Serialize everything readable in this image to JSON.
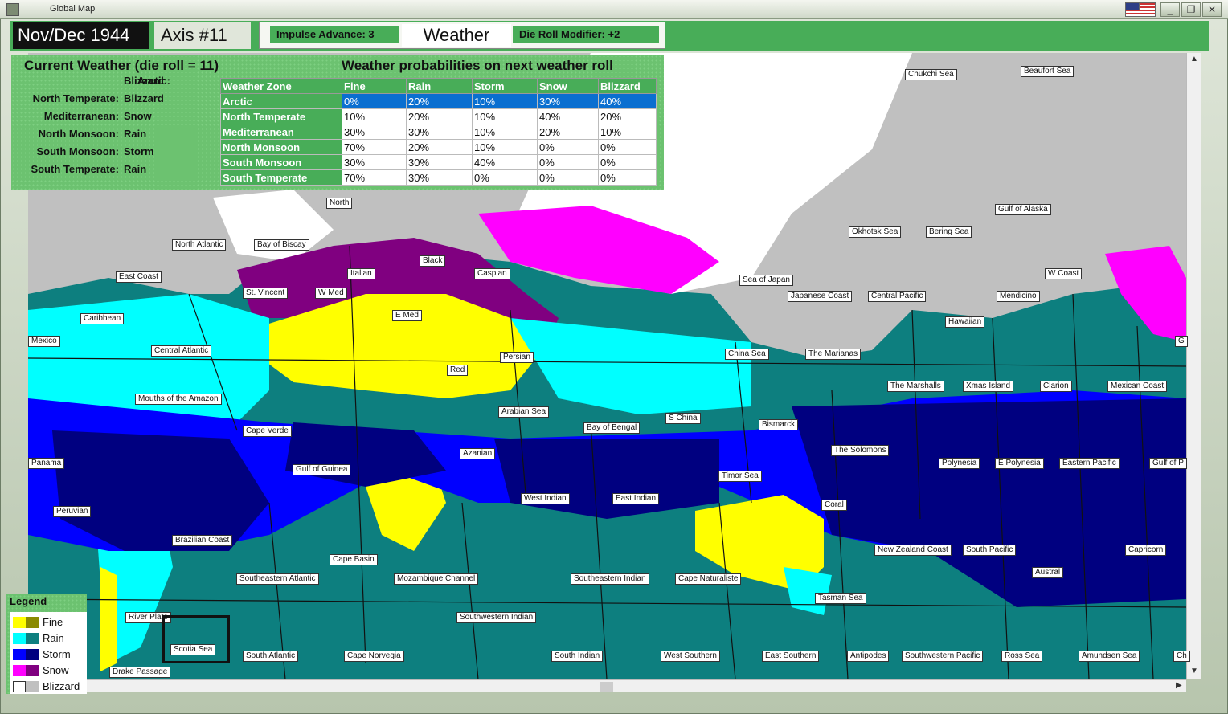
{
  "window": {
    "title": "Global Map"
  },
  "topbar": {
    "date": "Nov/Dec 1944",
    "turn": "Axis #11",
    "impulse_advance": "Impulse Advance:  3",
    "weather_button": "Weather",
    "die_roll_modifier": "Die Roll Modifier:  +2"
  },
  "current_weather": {
    "title": "Current Weather (die roll = 11)",
    "zones": [
      {
        "name": "Arctic:",
        "value": "Blizzard"
      },
      {
        "name": "North Temperate:",
        "value": "Blizzard"
      },
      {
        "name": "Mediterranean:",
        "value": "Snow"
      },
      {
        "name": "North Monsoon:",
        "value": "Rain"
      },
      {
        "name": "South Monsoon:",
        "value": "Storm"
      },
      {
        "name": "South Temperate:",
        "value": "Rain"
      }
    ]
  },
  "probabilities": {
    "title": "Weather probabilities on next weather roll",
    "headers": [
      "Weather Zone",
      "Fine",
      "Rain",
      "Storm",
      "Snow",
      "Blizzard"
    ],
    "rows": [
      [
        "Arctic",
        "0%",
        "20%",
        "10%",
        "30%",
        "40%"
      ],
      [
        "North Temperate",
        "10%",
        "20%",
        "10%",
        "40%",
        "20%"
      ],
      [
        "Mediterranean",
        "30%",
        "30%",
        "10%",
        "20%",
        "10%"
      ],
      [
        "North Monsoon",
        "70%",
        "20%",
        "10%",
        "0%",
        "0%"
      ],
      [
        "South Monsoon",
        "30%",
        "30%",
        "40%",
        "0%",
        "0%"
      ],
      [
        "South Temperate",
        "70%",
        "30%",
        "0%",
        "0%",
        "0%"
      ]
    ],
    "selected_row": "Arctic"
  },
  "legend": {
    "title": "Legend",
    "items": [
      {
        "label": "Fine",
        "color1": "#ffff00",
        "color2": "#8a8a00"
      },
      {
        "label": "Rain",
        "color1": "#00ffff",
        "color2": "#0d7f7f"
      },
      {
        "label": "Storm",
        "color1": "#0000ff",
        "color2": "#000080"
      },
      {
        "label": "Snow",
        "color1": "#ff00ff",
        "color2": "#800080"
      },
      {
        "label": "Blizzard",
        "color1": "#ffffff",
        "color2": "#c0c0c0"
      }
    ]
  },
  "map_labels": [
    "Chukchi Sea",
    "Beaufort Sea",
    "Gulf of Alaska",
    "Okhotsk Sea",
    "Bering Sea",
    "North",
    "North Atlantic",
    "Bay of Biscay",
    "Black",
    "Caspian",
    "Italian",
    "St. Vincent",
    "W Med",
    "Sea of Japan",
    "Japanese Coast",
    "Central Pacific",
    "Mendicino",
    "W Coast",
    "East Coast",
    "Caribbean",
    "E Med",
    "Hawaiian",
    "Mexico",
    "Central Atlantic",
    "Persian",
    "China Sea",
    "The Marianas",
    "Red",
    "Mouths of the Amazon",
    "The Marshalls",
    "Xmas Island",
    "Clarion",
    "Mexican Coast",
    "Arabian Sea",
    "S China",
    "Bismarck",
    "Cape Verde",
    "Bay of Bengal",
    "The Solomons",
    "Azanian",
    "Panama",
    "Polynesia",
    "E Polynesia",
    "Eastern Pacific",
    "Gulf of Guinea",
    "Gulf of P",
    "Timor Sea",
    "West Indian",
    "East Indian",
    "Coral",
    "Peruvian",
    "Brazilian Coast",
    "New Zealand Coast",
    "South Pacific",
    "Capricorn",
    "Cape Basin",
    "Austral",
    "Southeastern Atlantic",
    "Mozambique Channel",
    "Southeastern Indian",
    "Cape Naturaliste",
    "Tasman Sea",
    "River Plate",
    "Southwestern Indian",
    "Scotia Sea",
    "South Atlantic",
    "Cape Norvegia",
    "South Indian",
    "West Southern",
    "East Southern",
    "Antipodes",
    "Southwestern Pacific",
    "Ross Sea",
    "Amundsen Sea",
    "Drake Passage",
    "G",
    "Ch"
  ]
}
